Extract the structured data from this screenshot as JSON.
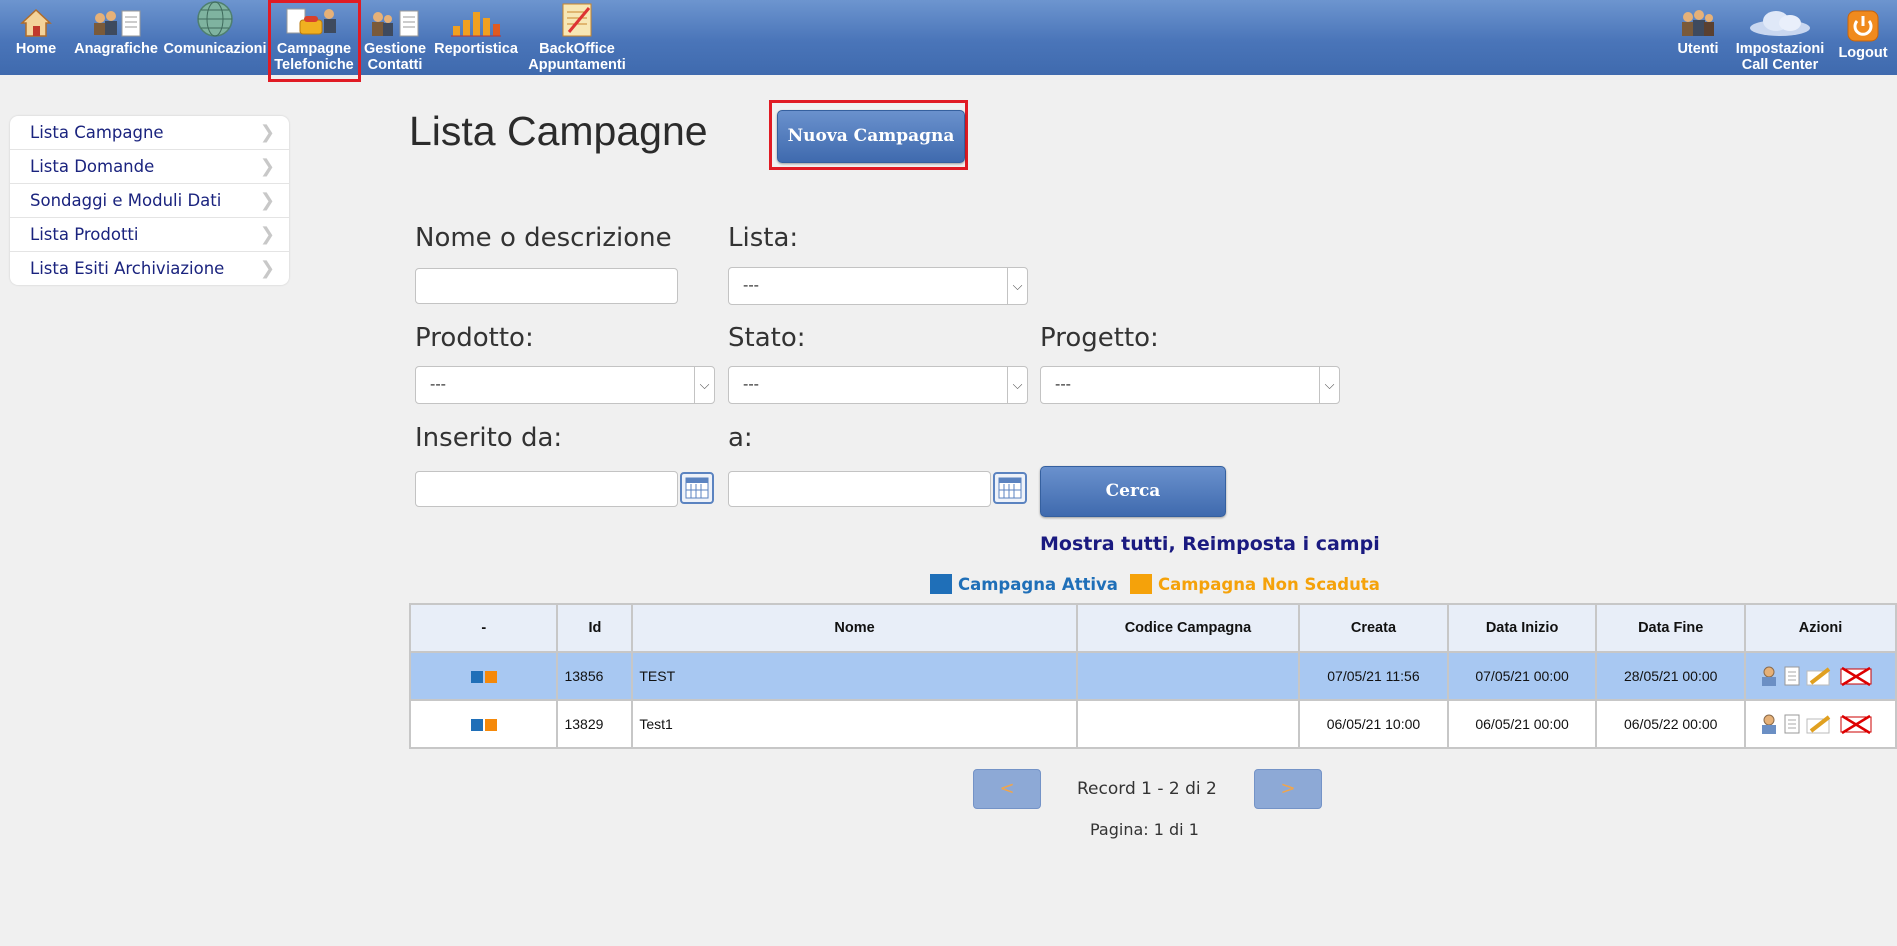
{
  "nav": {
    "left": [
      {
        "label": "Home",
        "icon": "home-icon"
      },
      {
        "label": "Anagrafiche",
        "icon": "people-doc-icon"
      },
      {
        "label": "Comunicazioni",
        "icon": "globe-icon"
      },
      {
        "label": "Campagne\nTelefoniche",
        "icon": "phone-campaign-icon"
      },
      {
        "label": "Gestione\nContatti",
        "icon": "contacts-icon"
      },
      {
        "label": "Reportistica",
        "icon": "bar-chart-icon"
      },
      {
        "label": "BackOffice\nAppuntamenti",
        "icon": "notebook-icon"
      }
    ],
    "right": [
      {
        "label": "Utenti",
        "icon": "users-icon"
      },
      {
        "label": "Impostazioni\nCall Center",
        "icon": "cloud-icon"
      },
      {
        "label": "Logout",
        "icon": "power-icon"
      }
    ]
  },
  "sidebar": {
    "items": [
      {
        "label": "Lista Campagne"
      },
      {
        "label": "Lista Domande"
      },
      {
        "label": "Sondaggi e Moduli Dati"
      },
      {
        "label": "Lista Prodotti"
      },
      {
        "label": "Lista Esiti Archiviazione"
      }
    ]
  },
  "main": {
    "title": "Lista Campagne",
    "new_button": "Nuova Campagna"
  },
  "filters": {
    "nome_label": "Nome o descrizione",
    "nome_value": "",
    "lista_label": "Lista:",
    "lista_value": "---",
    "prodotto_label": "Prodotto:",
    "prodotto_value": "---",
    "stato_label": "Stato:",
    "stato_value": "---",
    "progetto_label": "Progetto:",
    "progetto_value": "---",
    "inserito_da_label": "Inserito da:",
    "inserito_da_value": "",
    "a_label": "a:",
    "a_value": "",
    "search_button": "Cerca",
    "reset_link": "Mostra tutti, Reimposta i campi"
  },
  "legend": {
    "active_label": "Campagna Attiva",
    "active_color": "#1f6fb8",
    "not_expired_label": "Campagna Non Scaduta",
    "not_expired_color": "#f5a20a"
  },
  "table": {
    "columns": [
      "-",
      "Id",
      "Nome",
      "Codice Campagna",
      "Creata",
      "Data Inizio",
      "Data Fine",
      "Azioni"
    ],
    "rows": [
      {
        "id": "13856",
        "nome": "TEST",
        "codice": "",
        "creata": "07/05/21 11:56",
        "inizio": "07/05/21 00:00",
        "fine": "28/05/21 00:00"
      },
      {
        "id": "13829",
        "nome": "Test1",
        "codice": "",
        "creata": "06/05/21 10:00",
        "inizio": "06/05/21 00:00",
        "fine": "06/05/22 00:00"
      }
    ]
  },
  "pager": {
    "prev": "<",
    "next": ">",
    "record_text": "Record 1 - 2 di 2",
    "page_text": "Pagina: 1 di 1"
  },
  "colors": {
    "topbar": "#4a75b9",
    "highlight": "#e01b24",
    "row_selected": "#a8c8f2"
  }
}
